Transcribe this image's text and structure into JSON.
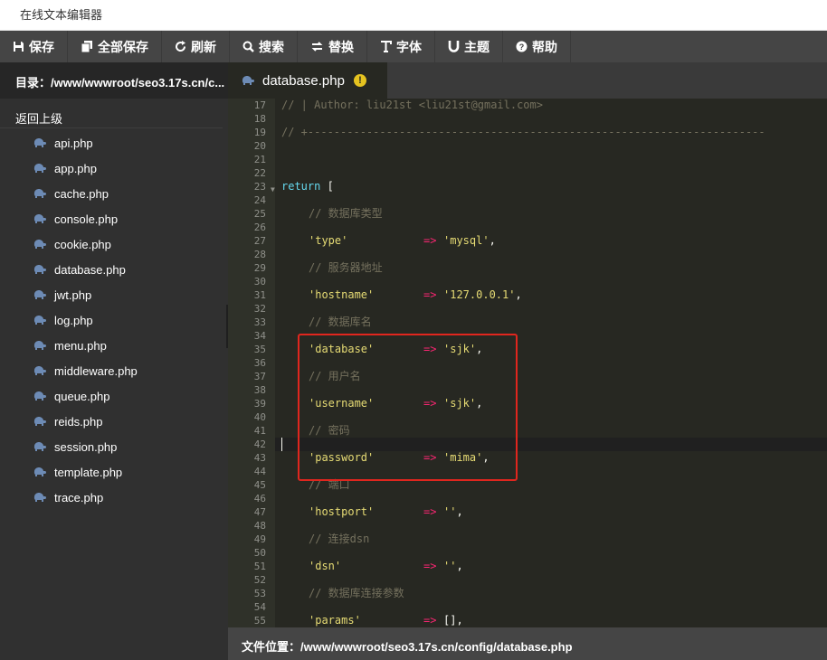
{
  "window": {
    "title": "在线文本编辑器"
  },
  "toolbar": {
    "buttons": [
      {
        "label": "保存",
        "icon": "save-icon"
      },
      {
        "label": "全部保存",
        "icon": "save-all-icon"
      },
      {
        "label": "刷新",
        "icon": "refresh-icon"
      },
      {
        "label": "搜索",
        "icon": "search-icon"
      },
      {
        "label": "替换",
        "icon": "replace-icon"
      },
      {
        "label": "字体",
        "icon": "font-icon"
      },
      {
        "label": "主题",
        "icon": "theme-icon"
      },
      {
        "label": "帮助",
        "icon": "help-icon"
      }
    ]
  },
  "sidebar": {
    "directory_label": "目录：/www/wwwroot/seo3.17s.cn/c...",
    "back_label": "返回上级",
    "file_icon": "php-elephant-icon",
    "files": [
      "api.php",
      "app.php",
      "cache.php",
      "console.php",
      "cookie.php",
      "database.php",
      "jwt.php",
      "log.php",
      "menu.php",
      "middleware.php",
      "queue.php",
      "reids.php",
      "session.php",
      "template.php",
      "trace.php"
    ]
  },
  "tab": {
    "label": "database.php",
    "warning_icon": "!"
  },
  "editor": {
    "line_numbers": [
      17,
      18,
      19,
      20,
      21,
      22,
      23,
      24,
      25,
      26,
      27,
      28,
      29,
      30,
      31,
      32,
      33,
      34,
      35,
      36,
      37,
      38,
      39,
      40,
      41,
      42,
      43,
      44,
      45,
      46,
      47,
      48,
      49,
      50,
      51,
      52,
      53,
      54,
      55
    ],
    "cursor_line": 42,
    "lines": {
      "l17": "// | Author: liu21st <liu21st@gmail.com>",
      "l19": "// +----------------------------------------------------------------------",
      "l23_kw": "return",
      "l23_rest": " [",
      "l25": "// 数据库类型",
      "l27": {
        "key": "'type'",
        "arrow": "=>",
        "val": "'mysql'",
        "end": ","
      },
      "l29": "// 服务器地址",
      "l31": {
        "key": "'hostname'",
        "arrow": "=>",
        "val": "'127.0.0.1'",
        "end": ","
      },
      "l33": "// 数据库名",
      "l35": {
        "key": "'database'",
        "arrow": "=>",
        "val": "'sjk'",
        "end": ","
      },
      "l37": "// 用户名",
      "l39": {
        "key": "'username'",
        "arrow": "=>",
        "val": "'sjk'",
        "end": ","
      },
      "l41": "// 密码",
      "l43": {
        "key": "'password'",
        "arrow": "=>",
        "val": "'mima'",
        "end": ","
      },
      "l45": "// 端口",
      "l47": {
        "key": "'hostport'",
        "arrow": "=>",
        "val": "''",
        "end": ","
      },
      "l49": "// 连接dsn",
      "l51": {
        "key": "'dsn'",
        "arrow": "=>",
        "val": "''",
        "end": ","
      },
      "l53": "// 数据库连接参数",
      "l55": {
        "key": "'params'",
        "arrow": "=>",
        "val": "[],",
        "end": ""
      }
    },
    "annotation_color": "#e0261e"
  },
  "statusbar": {
    "file_location": "文件位置：/www/wwwroot/seo3.17s.cn/config/database.php"
  },
  "colors": {
    "toolbar_bg": "#454545",
    "sidebar_bg": "#303030",
    "editor_bg": "#272822",
    "string": "#e6db74",
    "operator": "#f92672",
    "keyword": "#66d9ef",
    "comment": "#75715e"
  }
}
